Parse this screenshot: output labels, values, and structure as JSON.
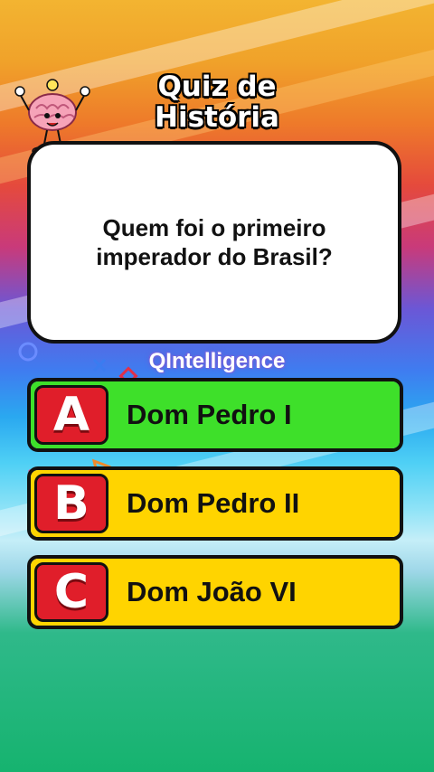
{
  "title": {
    "line1": "Quiz de",
    "line2": "História"
  },
  "question": "Quem foi o primeiro imperador do Brasil?",
  "brand": "QIntelligence",
  "answers": [
    {
      "letter": "A",
      "text": "Dom Pedro I",
      "color": "#3ee02a"
    },
    {
      "letter": "B",
      "text": "Dom Pedro II",
      "color": "#ffd400"
    },
    {
      "letter": "C",
      "text": "Dom João VI",
      "color": "#ffd400"
    }
  ],
  "colors": {
    "letter_bg": "#e01e2a",
    "border": "#111111"
  },
  "mascot": "brain-mascot"
}
